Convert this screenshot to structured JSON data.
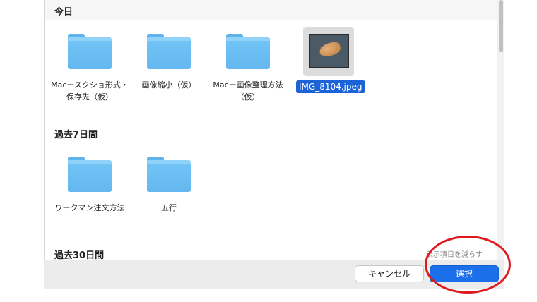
{
  "sections": {
    "today": {
      "title": "今日",
      "items": [
        {
          "label": "Macースクショ形式・保存先（仮）"
        },
        {
          "label": "画像縮小（仮）"
        },
        {
          "label": "Macー画像整理方法（仮）"
        },
        {
          "label": "IMG_8104.jpeg"
        }
      ]
    },
    "past7": {
      "title": "過去7日間",
      "items": [
        {
          "label": "ワークマン注文方法"
        },
        {
          "label": "五行"
        }
      ]
    },
    "past30": {
      "title": "過去30日間"
    }
  },
  "footer": {
    "hint": "表示項目を減らす",
    "cancel_label": "キャンセル",
    "select_label": "選択"
  },
  "colors": {
    "accent": "#1b6fe8",
    "folder": "#6ec0f3",
    "annotation": "#e0191e"
  },
  "icons": {
    "folder": "folder-icon",
    "image_thumbnail": "image-thumbnail-icon"
  }
}
